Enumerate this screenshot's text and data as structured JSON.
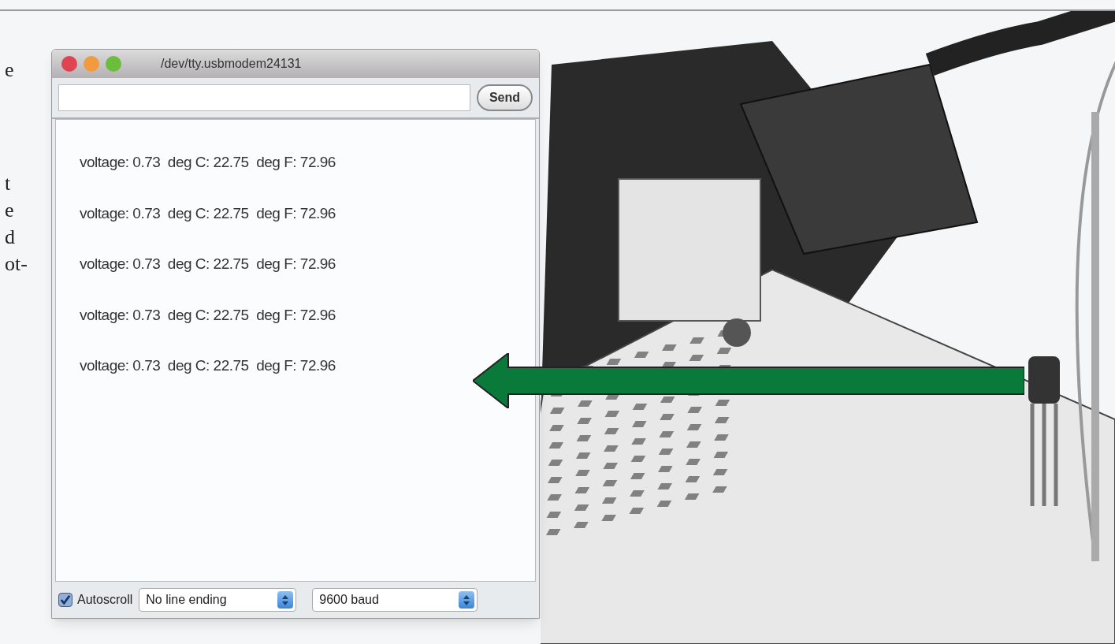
{
  "margin_text": [
    "e",
    "t",
    "e",
    "d",
    "ot-"
  ],
  "window": {
    "title": "/dev/tty.usbmodem24131"
  },
  "send_button": {
    "label": "Send"
  },
  "output_lines": [
    "voltage: 0.73  deg C: 22.75  deg F: 72.96",
    "voltage: 0.73  deg C: 22.75  deg F: 72.96",
    "voltage: 0.73  deg C: 22.75  deg F: 72.96",
    "voltage: 0.73  deg C: 22.75  deg F: 72.96",
    "voltage: 0.73  deg C: 22.75  deg F: 72.96"
  ],
  "autoscroll": {
    "label": "Autoscroll",
    "checked": true
  },
  "line_ending": {
    "value": "No line ending"
  },
  "baud": {
    "value": "9600 baud"
  }
}
